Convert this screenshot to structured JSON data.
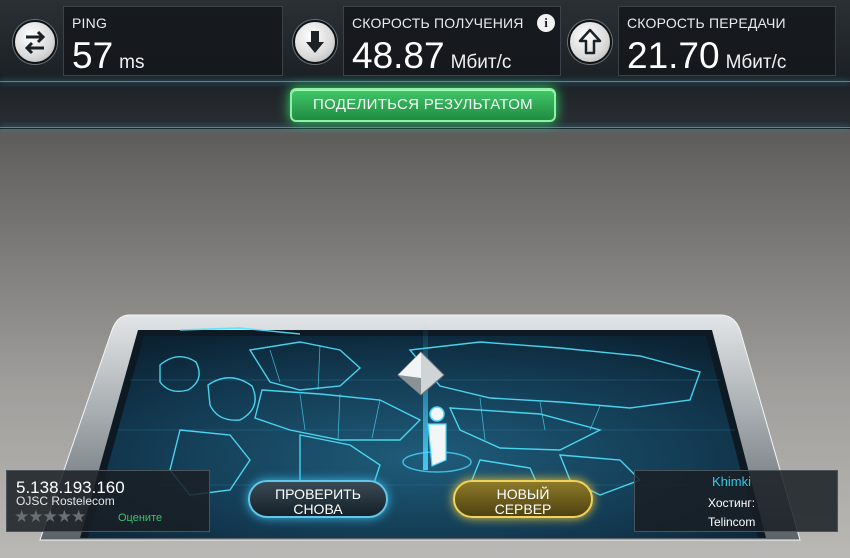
{
  "metrics": {
    "ping": {
      "label": "PING",
      "value": "57",
      "unit": "ms"
    },
    "download": {
      "label": "СКОРОСТЬ ПОЛУЧЕНИЯ",
      "value": "48.87",
      "unit": "Мбит/с"
    },
    "upload": {
      "label": "СКОРОСТЬ ПЕРЕДАЧИ",
      "value": "21.70",
      "unit": "Мбит/с"
    }
  },
  "info_glyph": "i",
  "share_button": "ПОДЕЛИТЬСЯ РЕЗУЛЬТАТОМ",
  "client": {
    "ip": "5.138.193.160",
    "isp": "OJSC Rostelecom",
    "stars": "★★★★★",
    "rate_label": "Оцените"
  },
  "buttons": {
    "test_again_line1": "ПРОВЕРИТЬ",
    "test_again_line2": "СНОВА",
    "new_server_line1": "НОВЫЙ",
    "new_server_line2": "СЕРВЕР"
  },
  "server": {
    "city": "Khimki",
    "hosting_label": "Хостинг:",
    "hoster": "Telincom"
  },
  "colors": {
    "accent_cyan": "#3fc1e8",
    "share_green": "#2fe06a",
    "server_gold": "#f0c93b"
  },
  "icons": [
    "ping-arrows-icon",
    "download-arrow-icon",
    "upload-arrow-icon",
    "info-icon",
    "server-pyramid-icon",
    "user-marker-icon"
  ]
}
